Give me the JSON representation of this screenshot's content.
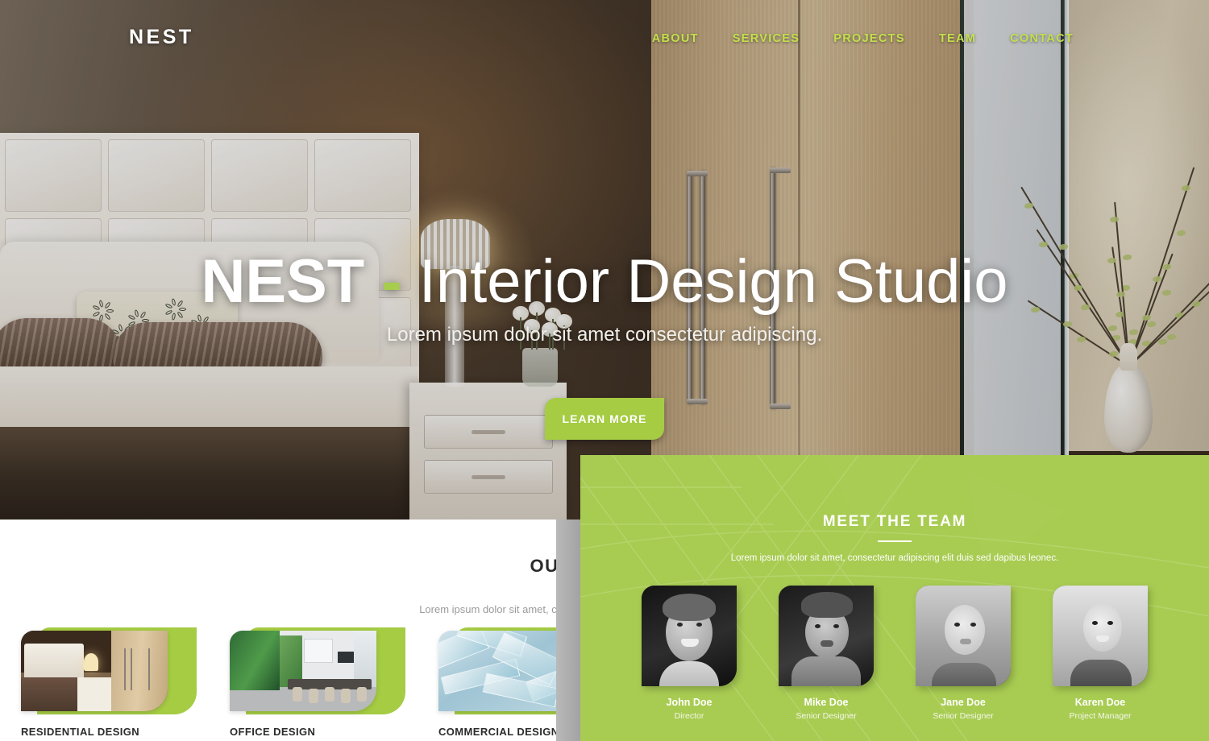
{
  "header": {
    "logo": "NEST",
    "nav": [
      {
        "label": "ABOUT"
      },
      {
        "label": "SERVICES"
      },
      {
        "label": "PROJECTS"
      },
      {
        "label": "TEAM"
      },
      {
        "label": "CONTACT"
      }
    ],
    "nav_color": "#c2e04b"
  },
  "hero": {
    "title_bold": "NEST",
    "title_dash": "-",
    "title_rest": "Interior Design Studio",
    "subtitle": "Lorem ipsum dolor sit amet consectetur adipiscing.",
    "cta_label": "LEARN MORE",
    "cta_color": "#a5cc43"
  },
  "services": {
    "heading": "OUR SERVICES",
    "subheading": "Lorem ipsum dolor sit amet, consectetur adipiscing elit duis sed dapibus leonec.",
    "accent_color": "#a5cc43",
    "cards": [
      {
        "label": "RESIDENTIAL DESIGN",
        "image": "bedroom-interior-photo"
      },
      {
        "label": "OFFICE DESIGN",
        "image": "conference-room-photo"
      },
      {
        "label": "COMMERCIAL DESIGN",
        "image": "glass-architecture-photo"
      }
    ]
  },
  "team": {
    "heading": "MEET THE TEAM",
    "subheading": "Lorem ipsum dolor sit amet, consectetur adipiscing elit duis sed dapibus leonec.",
    "panel_color": "#a8cc52",
    "members": [
      {
        "name": "John Doe",
        "role": "Director",
        "photo": "portrait-smiling-man"
      },
      {
        "name": "Mike Doe",
        "role": "Senior Designer",
        "photo": "portrait-man-hoodie"
      },
      {
        "name": "Jane Doe",
        "role": "Senior Designer",
        "photo": "portrait-woman-long-hair"
      },
      {
        "name": "Karen Doe",
        "role": "Project Manager",
        "photo": "portrait-woman-smiling"
      }
    ]
  }
}
